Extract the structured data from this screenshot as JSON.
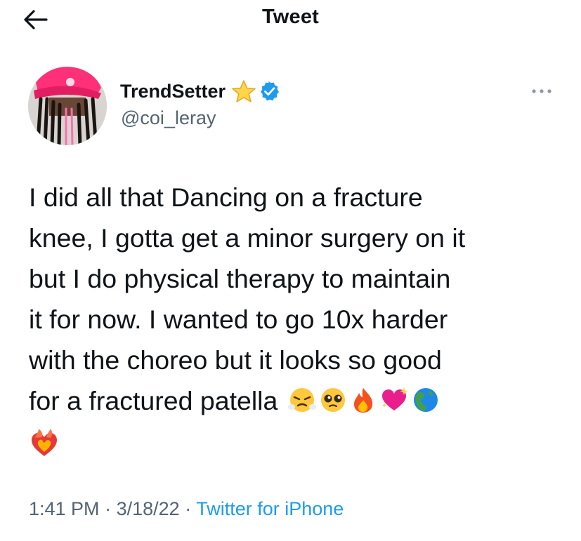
{
  "header": {
    "title": "Tweet",
    "back_icon": "arrow-left-icon"
  },
  "author": {
    "display_name": "TrendSetter",
    "handle": "@coi_leray",
    "badges": [
      "star-emoji-icon",
      "verified-badge-icon"
    ],
    "verified_color": "#1d9bf0"
  },
  "tweet": {
    "lines": [
      "I did all that Dancing on a fracture",
      "knee, I gotta get a minor surgery on it",
      "but I do physical therapy to maintain",
      "it for now. I wanted to go 10x harder",
      "with the choreo but it looks so good",
      "for a fractured patella"
    ],
    "emojis": [
      "face-with-steam-icon",
      "pleading-face-icon",
      "fire-icon",
      "sparkling-heart-icon",
      "globe-americas-icon",
      "heart-on-fire-icon"
    ]
  },
  "meta": {
    "time": "1:41 PM",
    "sep1": "·",
    "date": "3/18/22",
    "sep2": "·",
    "source": "Twitter for iPhone"
  },
  "colors": {
    "text": "#0f1419",
    "secondary": "#536471",
    "link": "#1d9bf0"
  }
}
